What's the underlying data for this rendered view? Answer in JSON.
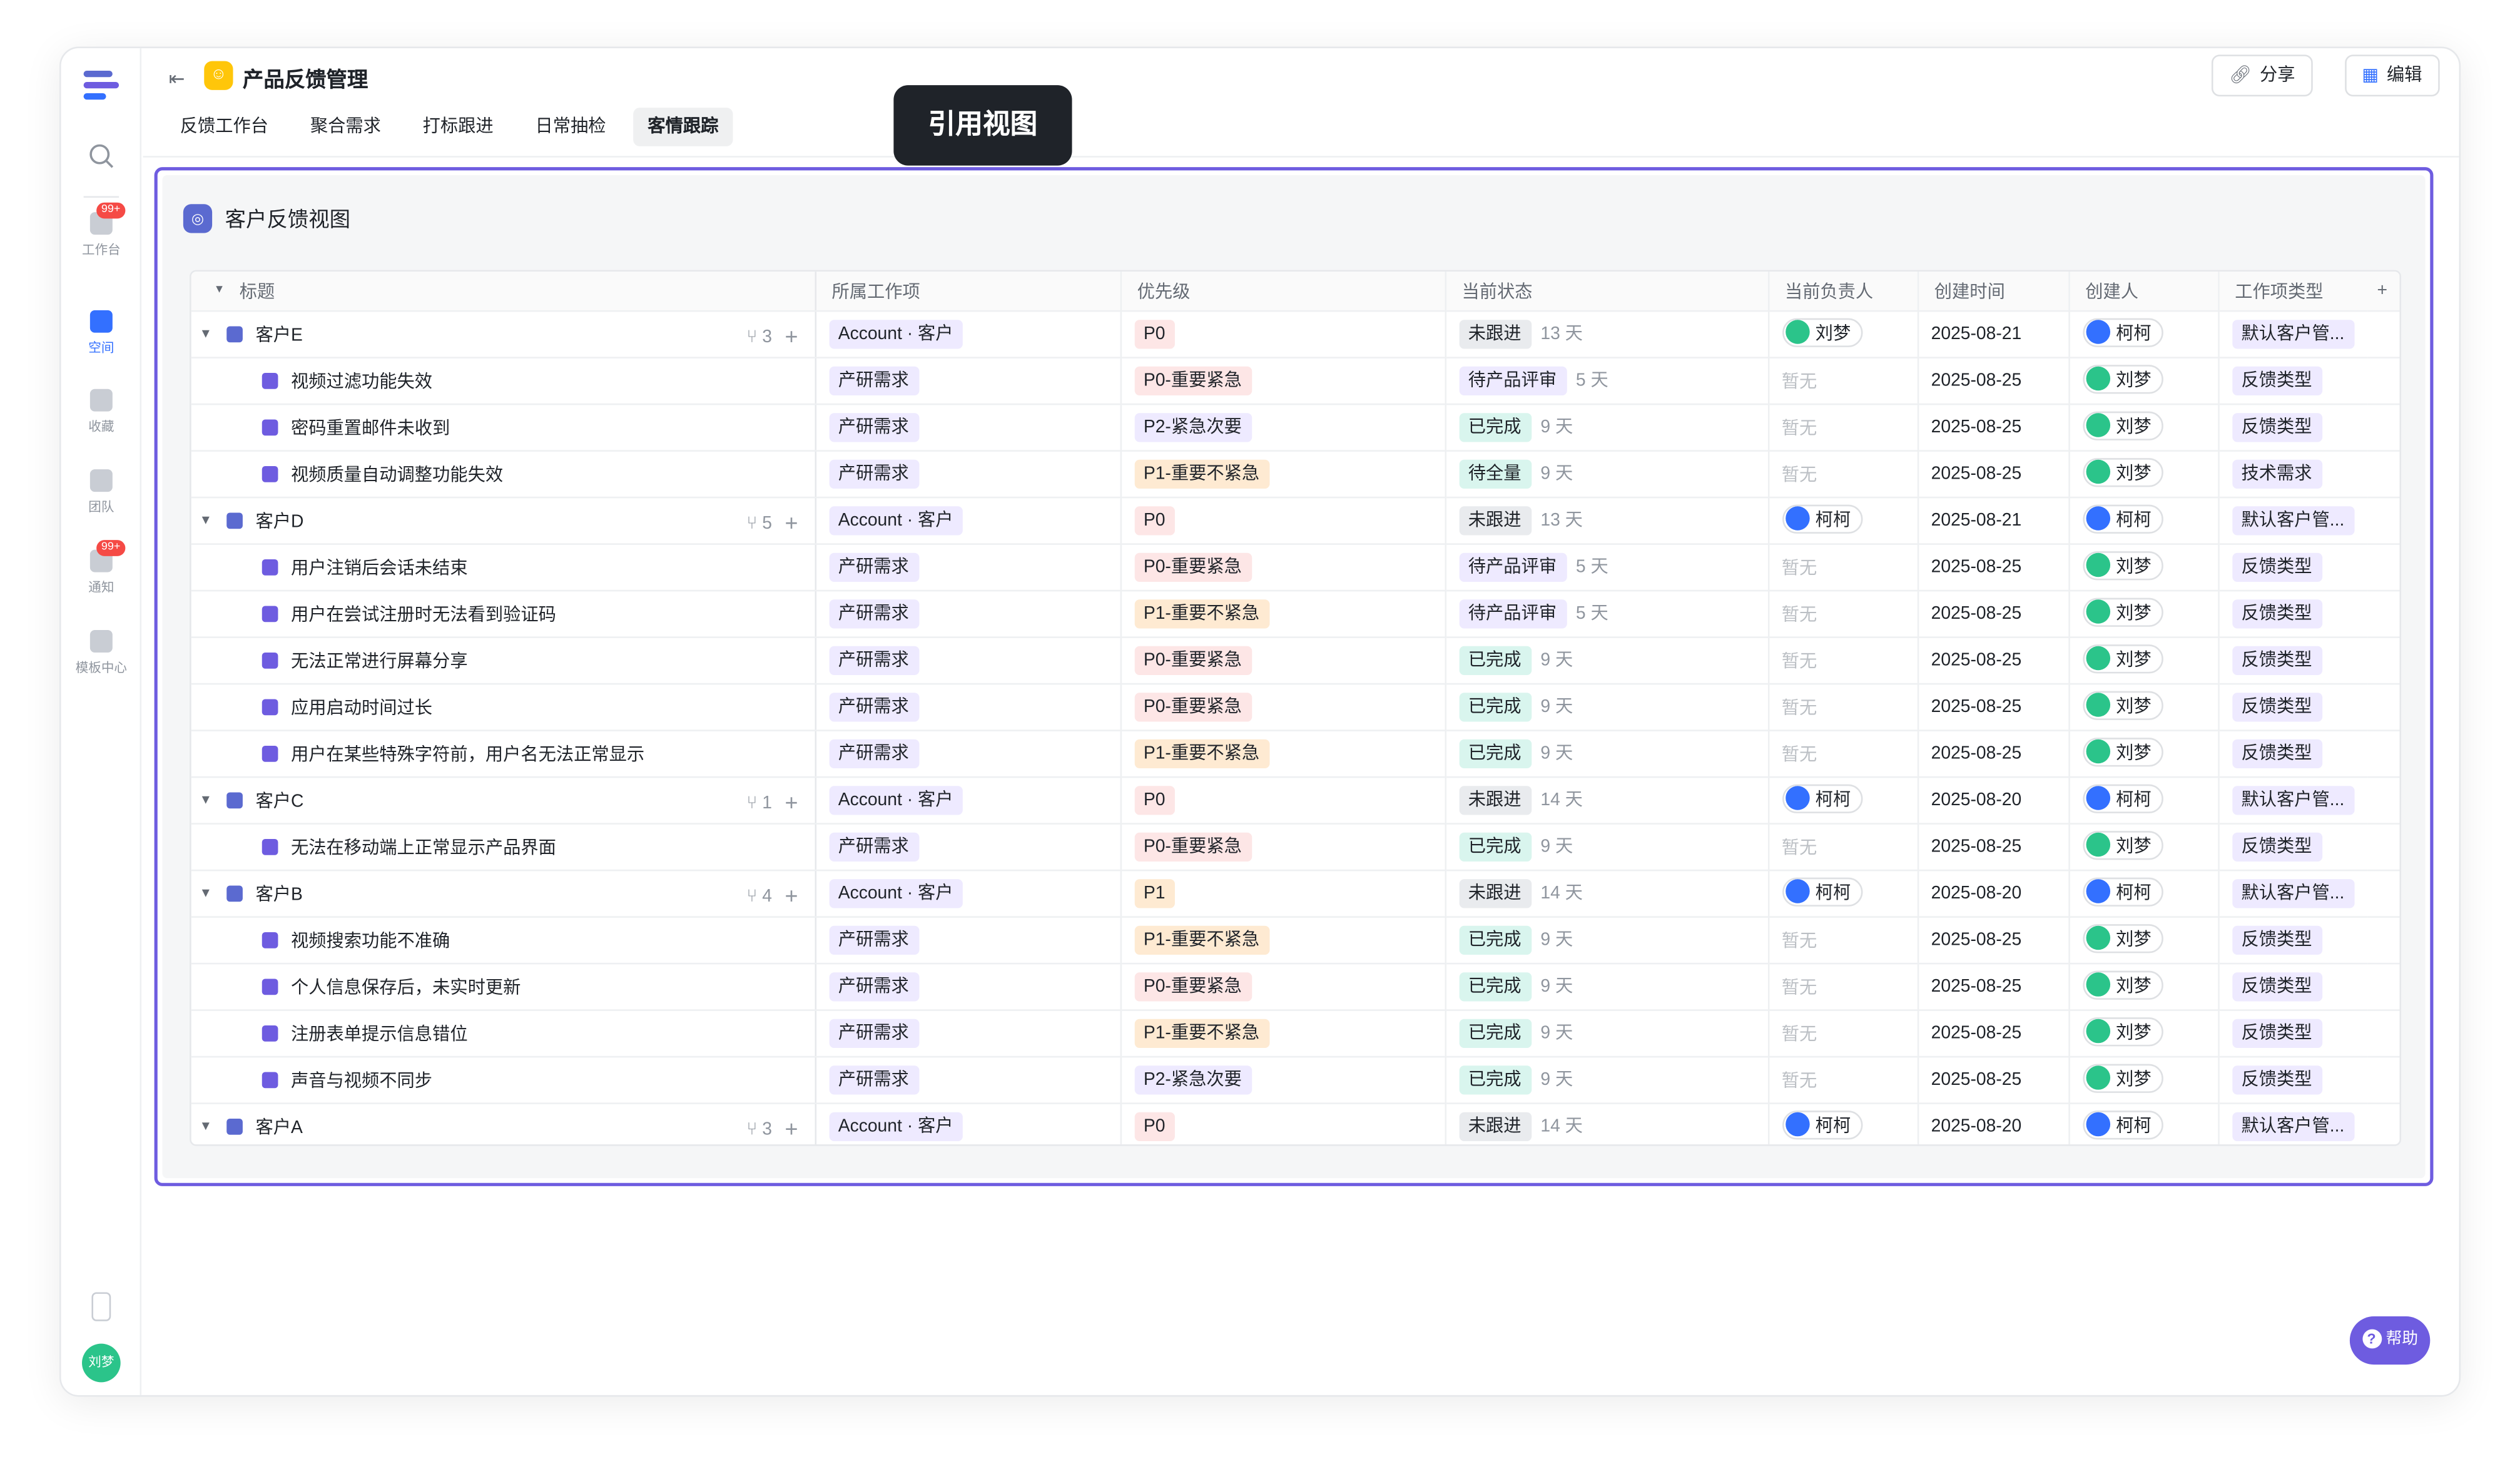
{
  "app": {
    "title": "产品反馈管理",
    "tabs": [
      "反馈工作台",
      "聚合需求",
      "打标跟进",
      "日常抽检",
      "客情跟踪"
    ],
    "active_tab": 4,
    "share_label": "分享",
    "edit_label": "编辑",
    "help_label": "帮助"
  },
  "rail": {
    "items": [
      {
        "label": "工作台",
        "badge": "99+"
      },
      {
        "label": "空间",
        "badge": ""
      },
      {
        "label": "收藏",
        "badge": ""
      },
      {
        "label": "团队",
        "badge": ""
      },
      {
        "label": "通知",
        "badge": "99+"
      },
      {
        "label": "模板中心",
        "badge": ""
      }
    ],
    "user_avatar": "刘梦"
  },
  "tooltip": "引用视图",
  "view": {
    "title": "客户反馈视图",
    "columns": [
      "标题",
      "所属工作项",
      "优先级",
      "当前状态",
      "当前负责人",
      "创建时间",
      "创建人",
      "工作项类型"
    ],
    "rows": [
      {
        "type": "group",
        "title": "客户E",
        "count": "3",
        "link": "Account · 客户",
        "priority": "P0",
        "pri_color": "pink",
        "status": "未跟进",
        "status_color": "gray",
        "days": "13 天",
        "owner": "刘梦",
        "owner_color": "green",
        "time": "2025-08-21",
        "creator": "柯柯",
        "creator_color": "blue",
        "wtype": "默认客户管..."
      },
      {
        "type": "child",
        "title": "视频过滤功能失效",
        "link": "产研需求",
        "priority": "P0-重要紧急",
        "pri_color": "pink",
        "status": "待产品评审",
        "status_color": "purple",
        "days": "5 天",
        "owner": "暂无",
        "time": "2025-08-25",
        "creator": "刘梦",
        "creator_color": "green",
        "wtype": "反馈类型"
      },
      {
        "type": "child",
        "title": "密码重置邮件未收到",
        "link": "产研需求",
        "priority": "P2-紧急次要",
        "pri_color": "purple",
        "status": "已完成",
        "status_color": "teal",
        "days": "9 天",
        "owner": "暂无",
        "time": "2025-08-25",
        "creator": "刘梦",
        "creator_color": "green",
        "wtype": "反馈类型"
      },
      {
        "type": "child",
        "title": "视频质量自动调整功能失效",
        "link": "产研需求",
        "priority": "P1-重要不紧急",
        "pri_color": "orange",
        "status": "待全量",
        "status_color": "teal",
        "days": "9 天",
        "owner": "暂无",
        "time": "2025-08-25",
        "creator": "刘梦",
        "creator_color": "green",
        "wtype": "技术需求"
      },
      {
        "type": "group",
        "title": "客户D",
        "count": "5",
        "link": "Account · 客户",
        "priority": "P0",
        "pri_color": "pink",
        "status": "未跟进",
        "status_color": "gray",
        "days": "13 天",
        "owner": "柯柯",
        "owner_color": "blue",
        "time": "2025-08-21",
        "creator": "柯柯",
        "creator_color": "blue",
        "wtype": "默认客户管..."
      },
      {
        "type": "child",
        "title": "用户注销后会话未结束",
        "link": "产研需求",
        "priority": "P0-重要紧急",
        "pri_color": "pink",
        "status": "待产品评审",
        "status_color": "purple",
        "days": "5 天",
        "owner": "暂无",
        "time": "2025-08-25",
        "creator": "刘梦",
        "creator_color": "green",
        "wtype": "反馈类型"
      },
      {
        "type": "child",
        "title": "用户在尝试注册时无法看到验证码",
        "link": "产研需求",
        "priority": "P1-重要不紧急",
        "pri_color": "orange",
        "status": "待产品评审",
        "status_color": "purple",
        "days": "5 天",
        "owner": "暂无",
        "time": "2025-08-25",
        "creator": "刘梦",
        "creator_color": "green",
        "wtype": "反馈类型"
      },
      {
        "type": "child",
        "title": "无法正常进行屏幕分享",
        "link": "产研需求",
        "priority": "P0-重要紧急",
        "pri_color": "pink",
        "status": "已完成",
        "status_color": "teal",
        "days": "9 天",
        "owner": "暂无",
        "time": "2025-08-25",
        "creator": "刘梦",
        "creator_color": "green",
        "wtype": "反馈类型"
      },
      {
        "type": "child",
        "title": "应用启动时间过长",
        "link": "产研需求",
        "priority": "P0-重要紧急",
        "pri_color": "pink",
        "status": "已完成",
        "status_color": "teal",
        "days": "9 天",
        "owner": "暂无",
        "time": "2025-08-25",
        "creator": "刘梦",
        "creator_color": "green",
        "wtype": "反馈类型"
      },
      {
        "type": "child",
        "title": "用户在某些特殊字符前，用户名无法正常显示",
        "link": "产研需求",
        "priority": "P1-重要不紧急",
        "pri_color": "orange",
        "status": "已完成",
        "status_color": "teal",
        "days": "9 天",
        "owner": "暂无",
        "time": "2025-08-25",
        "creator": "刘梦",
        "creator_color": "green",
        "wtype": "反馈类型"
      },
      {
        "type": "group",
        "title": "客户C",
        "count": "1",
        "link": "Account · 客户",
        "priority": "P0",
        "pri_color": "pink",
        "status": "未跟进",
        "status_color": "gray",
        "days": "14 天",
        "owner": "柯柯",
        "owner_color": "blue",
        "time": "2025-08-20",
        "creator": "柯柯",
        "creator_color": "blue",
        "wtype": "默认客户管..."
      },
      {
        "type": "child",
        "title": "无法在移动端上正常显示产品界面",
        "link": "产研需求",
        "priority": "P0-重要紧急",
        "pri_color": "pink",
        "status": "已完成",
        "status_color": "teal",
        "days": "9 天",
        "owner": "暂无",
        "time": "2025-08-25",
        "creator": "刘梦",
        "creator_color": "green",
        "wtype": "反馈类型"
      },
      {
        "type": "group",
        "title": "客户B",
        "count": "4",
        "link": "Account · 客户",
        "priority": "P1",
        "pri_color": "orange",
        "status": "未跟进",
        "status_color": "gray",
        "days": "14 天",
        "owner": "柯柯",
        "owner_color": "blue",
        "time": "2025-08-20",
        "creator": "柯柯",
        "creator_color": "blue",
        "wtype": "默认客户管..."
      },
      {
        "type": "child",
        "title": "视频搜索功能不准确",
        "link": "产研需求",
        "priority": "P1-重要不紧急",
        "pri_color": "orange",
        "status": "已完成",
        "status_color": "teal",
        "days": "9 天",
        "owner": "暂无",
        "time": "2025-08-25",
        "creator": "刘梦",
        "creator_color": "green",
        "wtype": "反馈类型"
      },
      {
        "type": "child",
        "title": "个人信息保存后，未实时更新",
        "link": "产研需求",
        "priority": "P0-重要紧急",
        "pri_color": "pink",
        "status": "已完成",
        "status_color": "teal",
        "days": "9 天",
        "owner": "暂无",
        "time": "2025-08-25",
        "creator": "刘梦",
        "creator_color": "green",
        "wtype": "反馈类型"
      },
      {
        "type": "child",
        "title": "注册表单提示信息错位",
        "link": "产研需求",
        "priority": "P1-重要不紧急",
        "pri_color": "orange",
        "status": "已完成",
        "status_color": "teal",
        "days": "9 天",
        "owner": "暂无",
        "time": "2025-08-25",
        "creator": "刘梦",
        "creator_color": "green",
        "wtype": "反馈类型"
      },
      {
        "type": "child",
        "title": "声音与视频不同步",
        "link": "产研需求",
        "priority": "P2-紧急次要",
        "pri_color": "purple",
        "status": "已完成",
        "status_color": "teal",
        "days": "9 天",
        "owner": "暂无",
        "time": "2025-08-25",
        "creator": "刘梦",
        "creator_color": "green",
        "wtype": "反馈类型"
      },
      {
        "type": "group",
        "title": "客户A",
        "count": "3",
        "link": "Account · 客户",
        "priority": "P0",
        "pri_color": "pink",
        "status": "未跟进",
        "status_color": "gray",
        "days": "14 天",
        "owner": "柯柯",
        "owner_color": "blue",
        "time": "2025-08-20",
        "creator": "柯柯",
        "creator_color": "blue",
        "wtype": "默认客户管..."
      }
    ]
  },
  "colors": {
    "accent": "#3370ff",
    "frame": "#6e5ce0",
    "brand_yellow": "#ffc60a",
    "badge_red": "#f54a45"
  }
}
